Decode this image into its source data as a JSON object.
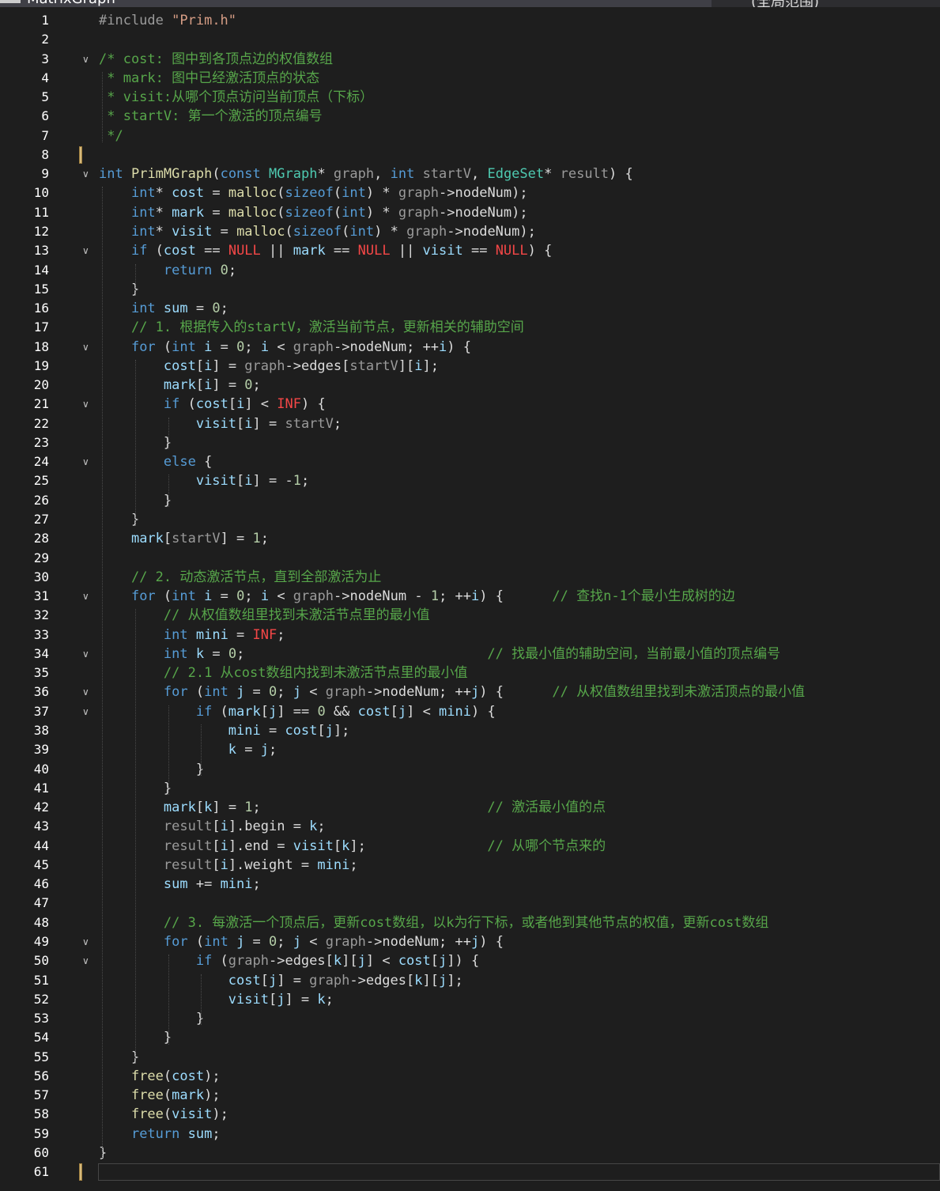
{
  "window": {
    "tabs": [
      {
        "label": "MatrixGraph",
        "active": true
      },
      {
        "label": "(全局范围)",
        "active": false
      }
    ]
  },
  "editor": {
    "language": "c",
    "theme_colors": {
      "keyword": "#569cd6",
      "type": "#4ec9b0",
      "function": "#dcdcaa",
      "variable": "#9cdcfe",
      "parameter": "#9a9a9a",
      "comment": "#57a64a",
      "number": "#b5cea8",
      "string": "#d69d85",
      "macro": "#f44747",
      "background": "#1e1e1e"
    },
    "lines": [
      {
        "n": "1",
        "text": "#include \"Prim.h\""
      },
      {
        "n": "2",
        "text": ""
      },
      {
        "n": "3",
        "text": "/* cost: 图中到各顶点边的权值数组"
      },
      {
        "n": "4",
        "text": " * mark: 图中已经激活顶点的状态"
      },
      {
        "n": "5",
        "text": " * visit:从哪个顶点访问当前顶点（下标）"
      },
      {
        "n": "6",
        "text": " * startV: 第一个激活的顶点编号"
      },
      {
        "n": "7",
        "text": " */"
      },
      {
        "n": "8",
        "text": ""
      },
      {
        "n": "9",
        "text": "int PrimMGraph(const MGraph* graph, int startV, EdgeSet* result) {"
      },
      {
        "n": "10",
        "text": "    int* cost = malloc(sizeof(int) * graph->nodeNum);"
      },
      {
        "n": "11",
        "text": "    int* mark = malloc(sizeof(int) * graph->nodeNum);"
      },
      {
        "n": "12",
        "text": "    int* visit = malloc(sizeof(int) * graph->nodeNum);"
      },
      {
        "n": "13",
        "text": "    if (cost == NULL || mark == NULL || visit == NULL) {"
      },
      {
        "n": "14",
        "text": "        return 0;"
      },
      {
        "n": "15",
        "text": "    }"
      },
      {
        "n": "16",
        "text": "    int sum = 0;"
      },
      {
        "n": "17",
        "text": "    // 1. 根据传入的startV，激活当前节点，更新相关的辅助空间"
      },
      {
        "n": "18",
        "text": "    for (int i = 0; i < graph->nodeNum; ++i) {"
      },
      {
        "n": "19",
        "text": "        cost[i] = graph->edges[startV][i];"
      },
      {
        "n": "20",
        "text": "        mark[i] = 0;"
      },
      {
        "n": "21",
        "text": "        if (cost[i] < INF) {"
      },
      {
        "n": "22",
        "text": "            visit[i] = startV;"
      },
      {
        "n": "23",
        "text": "        }"
      },
      {
        "n": "24",
        "text": "        else {"
      },
      {
        "n": "25",
        "text": "            visit[i] = -1;"
      },
      {
        "n": "26",
        "text": "        }"
      },
      {
        "n": "27",
        "text": "    }"
      },
      {
        "n": "28",
        "text": "    mark[startV] = 1;"
      },
      {
        "n": "29",
        "text": ""
      },
      {
        "n": "30",
        "text": "    // 2. 动态激活节点，直到全部激活为止"
      },
      {
        "n": "31",
        "text": "    for (int i = 0; i < graph->nodeNum - 1; ++i) {      // 查找n-1个最小生成树的边"
      },
      {
        "n": "32",
        "text": "        // 从权值数组里找到未激活节点里的最小值"
      },
      {
        "n": "33",
        "text": "        int mini = INF;"
      },
      {
        "n": "34",
        "text": "        int k = 0;                              // 找最小值的辅助空间，当前最小值的顶点编号"
      },
      {
        "n": "35",
        "text": "        // 2.1 从cost数组内找到未激活节点里的最小值"
      },
      {
        "n": "36",
        "text": "        for (int j = 0; j < graph->nodeNum; ++j) {      // 从权值数组里找到未激活顶点的最小值"
      },
      {
        "n": "37",
        "text": "            if (mark[j] == 0 && cost[j] < mini) {"
      },
      {
        "n": "38",
        "text": "                mini = cost[j];"
      },
      {
        "n": "39",
        "text": "                k = j;"
      },
      {
        "n": "40",
        "text": "            }"
      },
      {
        "n": "41",
        "text": "        }"
      },
      {
        "n": "42",
        "text": "        mark[k] = 1;                            // 激活最小值的点"
      },
      {
        "n": "43",
        "text": "        result[i].begin = k;"
      },
      {
        "n": "44",
        "text": "        result[i].end = visit[k];               // 从哪个节点来的"
      },
      {
        "n": "45",
        "text": "        result[i].weight = mini;"
      },
      {
        "n": "46",
        "text": "        sum += mini;"
      },
      {
        "n": "47",
        "text": ""
      },
      {
        "n": "48",
        "text": "        // 3. 每激活一个顶点后，更新cost数组，以k为行下标，或者他到其他节点的权值，更新cost数组"
      },
      {
        "n": "49",
        "text": "        for (int j = 0; j < graph->nodeNum; ++j) {"
      },
      {
        "n": "50",
        "text": "            if (graph->edges[k][j] < cost[j]) {"
      },
      {
        "n": "51",
        "text": "                cost[j] = graph->edges[k][j];"
      },
      {
        "n": "52",
        "text": "                visit[j] = k;"
      },
      {
        "n": "53",
        "text": "            }"
      },
      {
        "n": "54",
        "text": "        }"
      },
      {
        "n": "55",
        "text": "    }"
      },
      {
        "n": "56",
        "text": "    free(cost);"
      },
      {
        "n": "57",
        "text": "    free(mark);"
      },
      {
        "n": "58",
        "text": "    free(visit);"
      },
      {
        "n": "59",
        "text": "    return sum;"
      },
      {
        "n": "60",
        "text": "}"
      },
      {
        "n": "61",
        "text": ""
      }
    ]
  }
}
